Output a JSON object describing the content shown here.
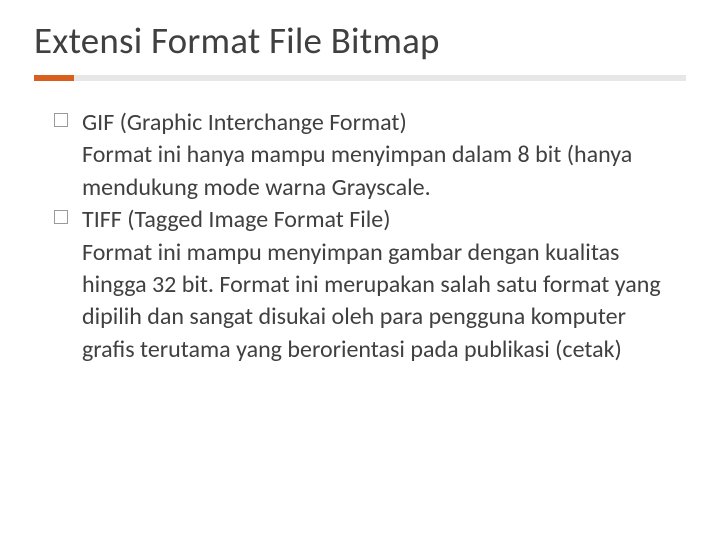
{
  "title": "Extensi Format File Bitmap",
  "items": [
    {
      "heading": "GIF (Graphic Interchange Format)",
      "detail": "Format ini hanya mampu menyimpan dalam 8 bit (hanya mendukung mode warna Grayscale."
    },
    {
      "heading": "TIFF (Tagged Image Format File)",
      "detail": "Format ini mampu menyimpan gambar dengan kualitas hingga 32 bit. Format ini merupakan salah satu format yang dipilih dan sangat disukai oleh para pengguna komputer grafis terutama yang berorientasi pada publikasi (cetak)"
    }
  ]
}
